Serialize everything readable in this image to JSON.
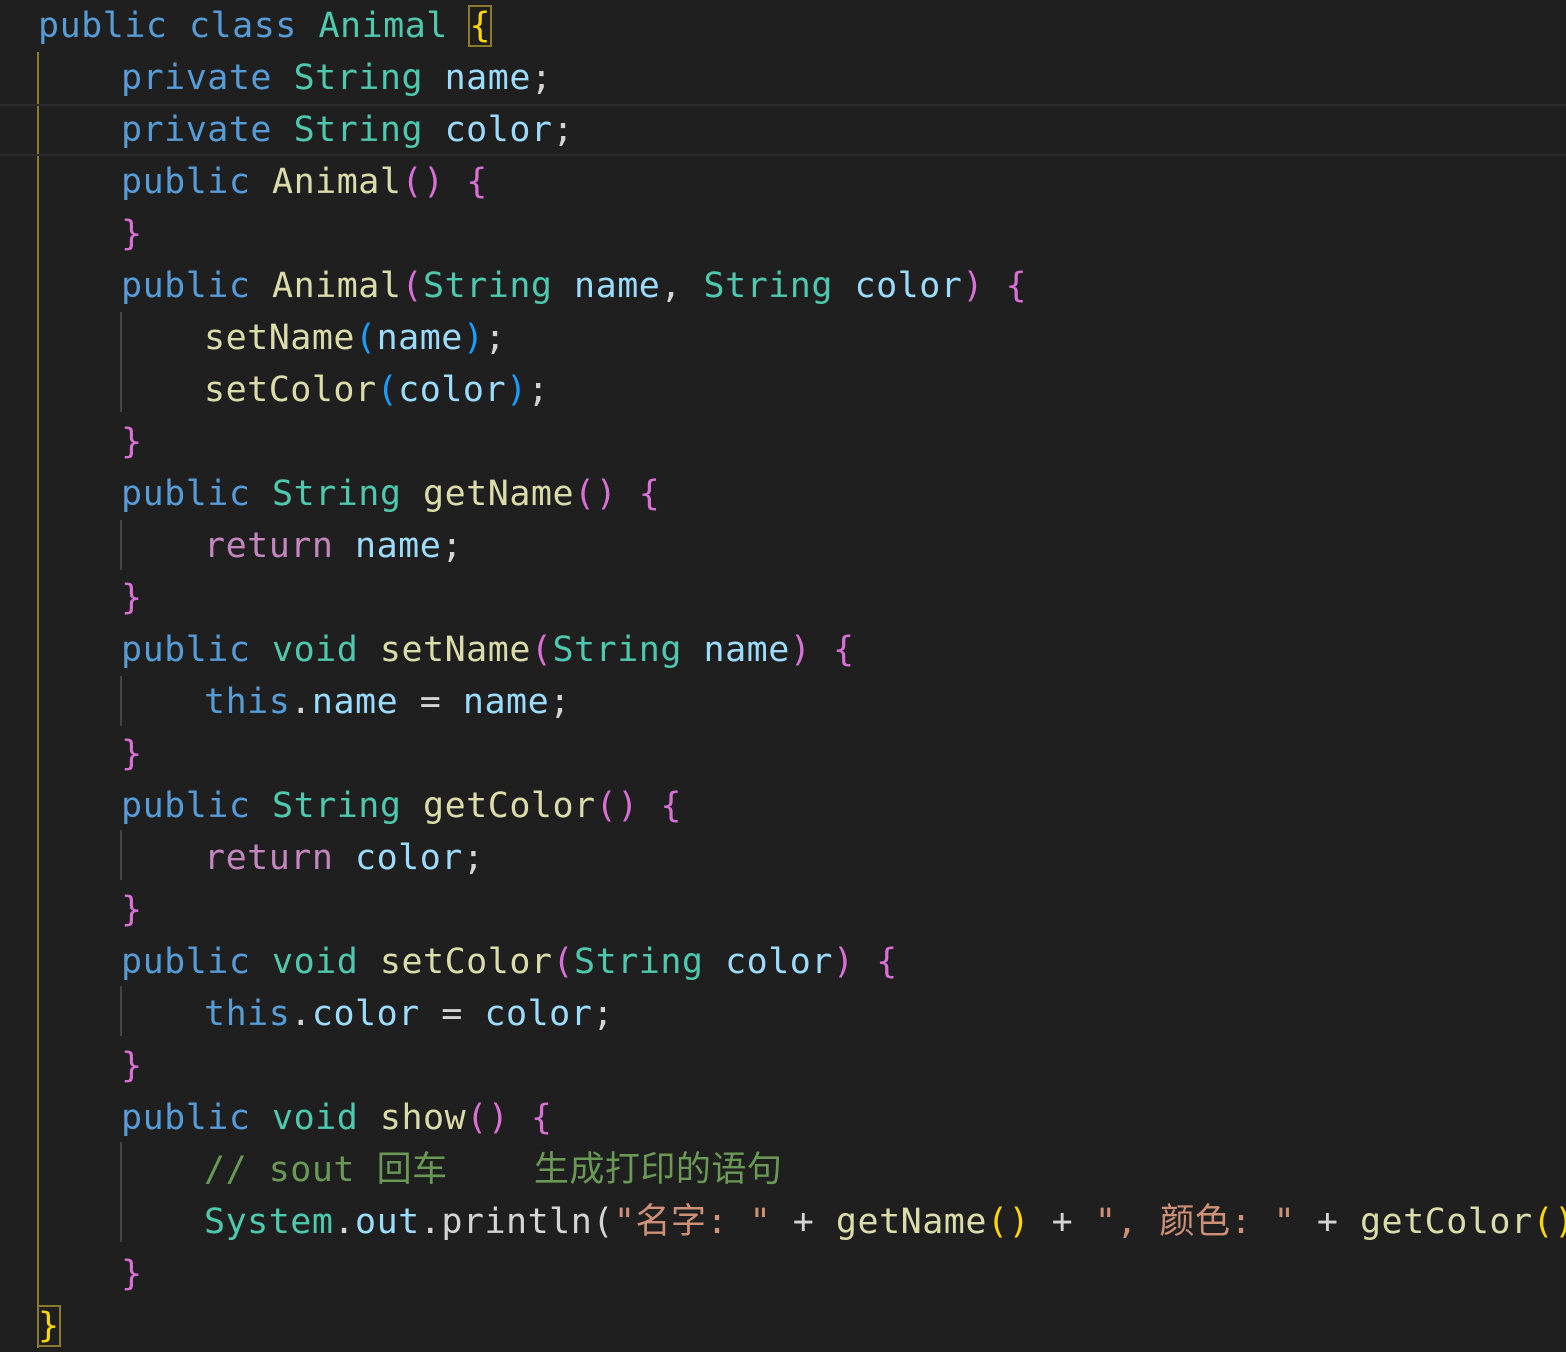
{
  "colors": {
    "background": "#1f1f1f",
    "keyword": "#569cd6",
    "control": "#c586c0",
    "type": "#4ec9b0",
    "function": "#dcdcaa",
    "variable": "#9cdcfe",
    "string": "#ce9178",
    "comment": "#6a9955",
    "punct": "#d4d4d4",
    "brace_gold": "#ffd700",
    "brace_pink": "#da70d6",
    "brace_blue": "#179fff"
  },
  "lines": [
    {
      "indent": 0,
      "tokens": [
        [
          "public",
          "keyword"
        ],
        [
          " ",
          ""
        ],
        [
          "class",
          "keyword"
        ],
        [
          " ",
          ""
        ],
        [
          "Animal",
          "type"
        ],
        [
          " ",
          ""
        ],
        [
          "{",
          "brace_gold match"
        ]
      ]
    },
    {
      "indent": 1,
      "tokens": [
        [
          "private",
          "keyword"
        ],
        [
          " ",
          ""
        ],
        [
          "String",
          "type"
        ],
        [
          " ",
          ""
        ],
        [
          "name",
          "variable"
        ],
        [
          ";",
          "punct"
        ]
      ]
    },
    {
      "indent": 1,
      "current": true,
      "tokens": [
        [
          "private",
          "keyword"
        ],
        [
          " ",
          ""
        ],
        [
          "String",
          "type"
        ],
        [
          " ",
          ""
        ],
        [
          "color",
          "variable"
        ],
        [
          ";",
          "punct"
        ]
      ]
    },
    {
      "indent": 1,
      "tokens": [
        [
          "public",
          "keyword"
        ],
        [
          " ",
          ""
        ],
        [
          "Animal",
          "function"
        ],
        [
          "()",
          "brace_pink"
        ],
        [
          " ",
          ""
        ],
        [
          "{",
          "brace_pink"
        ]
      ]
    },
    {
      "indent": 1,
      "tokens": [
        [
          "}",
          "brace_pink"
        ]
      ]
    },
    {
      "indent": 1,
      "tokens": [
        [
          "public",
          "keyword"
        ],
        [
          " ",
          ""
        ],
        [
          "Animal",
          "function"
        ],
        [
          "(",
          "brace_pink"
        ],
        [
          "String",
          "type"
        ],
        [
          " ",
          ""
        ],
        [
          "name",
          "variable"
        ],
        [
          ", ",
          "punct"
        ],
        [
          "String",
          "type"
        ],
        [
          " ",
          ""
        ],
        [
          "color",
          "variable"
        ],
        [
          ")",
          "brace_pink"
        ],
        [
          " ",
          ""
        ],
        [
          "{",
          "brace_pink"
        ]
      ]
    },
    {
      "indent": 2,
      "tokens": [
        [
          "setName",
          "function"
        ],
        [
          "(",
          "brace_blue"
        ],
        [
          "name",
          "variable"
        ],
        [
          ")",
          "brace_blue"
        ],
        [
          ";",
          "punct"
        ]
      ]
    },
    {
      "indent": 2,
      "tokens": [
        [
          "setColor",
          "function"
        ],
        [
          "(",
          "brace_blue"
        ],
        [
          "color",
          "variable"
        ],
        [
          ")",
          "brace_blue"
        ],
        [
          ";",
          "punct"
        ]
      ]
    },
    {
      "indent": 1,
      "tokens": [
        [
          "}",
          "brace_pink"
        ]
      ]
    },
    {
      "indent": 1,
      "tokens": [
        [
          "public",
          "keyword"
        ],
        [
          " ",
          ""
        ],
        [
          "String",
          "type"
        ],
        [
          " ",
          ""
        ],
        [
          "getName",
          "function"
        ],
        [
          "()",
          "brace_pink"
        ],
        [
          " ",
          ""
        ],
        [
          "{",
          "brace_pink"
        ]
      ]
    },
    {
      "indent": 2,
      "tokens": [
        [
          "return",
          "control"
        ],
        [
          " ",
          ""
        ],
        [
          "name",
          "variable"
        ],
        [
          ";",
          "punct"
        ]
      ]
    },
    {
      "indent": 1,
      "tokens": [
        [
          "}",
          "brace_pink"
        ]
      ]
    },
    {
      "indent": 1,
      "tokens": [
        [
          "public",
          "keyword"
        ],
        [
          " ",
          ""
        ],
        [
          "void",
          "type"
        ],
        [
          " ",
          ""
        ],
        [
          "setName",
          "function"
        ],
        [
          "(",
          "brace_pink"
        ],
        [
          "String",
          "type"
        ],
        [
          " ",
          ""
        ],
        [
          "name",
          "variable"
        ],
        [
          ")",
          "brace_pink"
        ],
        [
          " ",
          ""
        ],
        [
          "{",
          "brace_pink"
        ]
      ]
    },
    {
      "indent": 2,
      "tokens": [
        [
          "this",
          "keyword"
        ],
        [
          ".",
          "punct"
        ],
        [
          "name",
          "variable"
        ],
        [
          " = ",
          "punct"
        ],
        [
          "name",
          "variable"
        ],
        [
          ";",
          "punct"
        ]
      ]
    },
    {
      "indent": 1,
      "tokens": [
        [
          "}",
          "brace_pink"
        ]
      ]
    },
    {
      "indent": 1,
      "tokens": [
        [
          "public",
          "keyword"
        ],
        [
          " ",
          ""
        ],
        [
          "String",
          "type"
        ],
        [
          " ",
          ""
        ],
        [
          "getColor",
          "function"
        ],
        [
          "()",
          "brace_pink"
        ],
        [
          " ",
          ""
        ],
        [
          "{",
          "brace_pink"
        ]
      ]
    },
    {
      "indent": 2,
      "tokens": [
        [
          "return",
          "control"
        ],
        [
          " ",
          ""
        ],
        [
          "color",
          "variable"
        ],
        [
          ";",
          "punct"
        ]
      ]
    },
    {
      "indent": 1,
      "tokens": [
        [
          "}",
          "brace_pink"
        ]
      ]
    },
    {
      "indent": 1,
      "tokens": [
        [
          "public",
          "keyword"
        ],
        [
          " ",
          ""
        ],
        [
          "void",
          "type"
        ],
        [
          " ",
          ""
        ],
        [
          "setColor",
          "function"
        ],
        [
          "(",
          "brace_pink"
        ],
        [
          "String",
          "type"
        ],
        [
          " ",
          ""
        ],
        [
          "color",
          "variable"
        ],
        [
          ")",
          "brace_pink"
        ],
        [
          " ",
          ""
        ],
        [
          "{",
          "brace_pink"
        ]
      ]
    },
    {
      "indent": 2,
      "tokens": [
        [
          "this",
          "keyword"
        ],
        [
          ".",
          "punct"
        ],
        [
          "color",
          "variable"
        ],
        [
          " = ",
          "punct"
        ],
        [
          "color",
          "variable"
        ],
        [
          ";",
          "punct"
        ]
      ]
    },
    {
      "indent": 1,
      "tokens": [
        [
          "}",
          "brace_pink"
        ]
      ]
    },
    {
      "indent": 1,
      "tokens": [
        [
          "public",
          "keyword"
        ],
        [
          " ",
          ""
        ],
        [
          "void",
          "type"
        ],
        [
          " ",
          ""
        ],
        [
          "show",
          "function"
        ],
        [
          "()",
          "brace_pink"
        ],
        [
          " ",
          ""
        ],
        [
          "{",
          "brace_pink"
        ]
      ]
    },
    {
      "indent": 2,
      "tokens": [
        [
          "// sout 回车    生成打印的语句",
          "comment"
        ]
      ]
    },
    {
      "indent": 2,
      "tokens": [
        [
          "System",
          "type"
        ],
        [
          ".",
          "punct"
        ],
        [
          "out",
          "variable"
        ],
        [
          ".",
          "punct"
        ],
        [
          "println",
          "punct"
        ],
        [
          "(",
          "punct"
        ],
        [
          "\"名字: \"",
          "string"
        ],
        [
          " + ",
          "punct"
        ],
        [
          "getName",
          "function"
        ],
        [
          "()",
          "brace_gold"
        ],
        [
          " + ",
          "punct"
        ],
        [
          "\", 颜色: \"",
          "string"
        ],
        [
          " + ",
          "punct"
        ],
        [
          "getColor",
          "function"
        ],
        [
          "()",
          "brace_gold"
        ],
        [
          ")",
          "brace_blue"
        ],
        [
          ";",
          "punct"
        ]
      ]
    },
    {
      "indent": 1,
      "tokens": [
        [
          "}",
          "brace_pink"
        ]
      ]
    },
    {
      "indent": 0,
      "tokens": [
        [
          "}",
          "brace_gold match"
        ]
      ]
    }
  ]
}
